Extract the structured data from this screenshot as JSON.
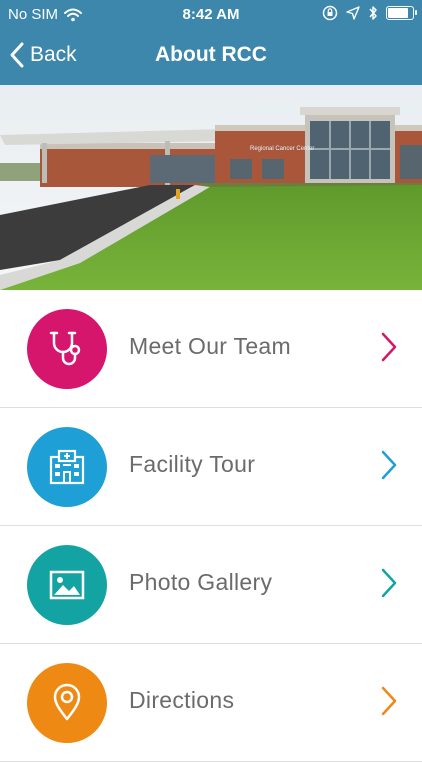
{
  "status": {
    "carrier": "No SIM",
    "time": "8:42 AM",
    "battery_level": 0.9
  },
  "nav": {
    "back_label": "Back",
    "title": "About RCC"
  },
  "hero": {
    "building_sign": "Regional Cancer Center"
  },
  "menu": {
    "items": [
      {
        "label": "Meet Our Team",
        "icon": "stethoscope-icon",
        "color": "#d6156c"
      },
      {
        "label": "Facility Tour",
        "icon": "hospital-icon",
        "color": "#1ea0d6"
      },
      {
        "label": "Photo Gallery",
        "icon": "picture-icon",
        "color": "#14a3a3"
      },
      {
        "label": "Directions",
        "icon": "map-pin-icon",
        "color": "#ee8a13"
      }
    ]
  }
}
